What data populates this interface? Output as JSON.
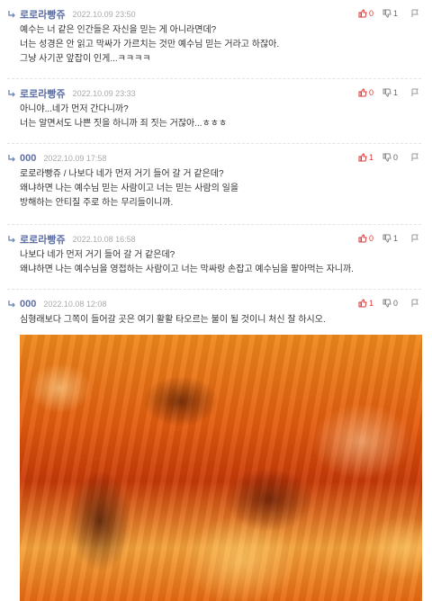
{
  "icons": {
    "reply": "reply-arrow-icon",
    "upvote": "thumbs-up-icon",
    "downvote": "thumbs-down-icon",
    "report": "report-icon"
  },
  "colors": {
    "author": "#5b6ea6",
    "upvote": "#d93a3a",
    "text": "#333333"
  },
  "comments": [
    {
      "author": "로로라빵쥬",
      "date": "2022.10.09 23:50",
      "up": "0",
      "down": "1",
      "lines": [
        "예수는 너 같은 인간들은 자신을 믿는 게 아니라면데?",
        "너는 성경은 안 읽고 막싸가 가르치는 것만 예수님 믿는 거라고 하잖아.",
        "그냥 사기꾼 앞잡이 인게...ㅋㅋㅋㅋ"
      ]
    },
    {
      "author": "로로라빵쥬",
      "date": "2022.10.09 23:33",
      "up": "0",
      "down": "1",
      "lines": [
        "아니야...네가 먼저 간다니까?",
        "너는 알면서도 나쁜 짓을 하니까 죄 짓는 거잖아...ㅎㅎㅎ"
      ]
    },
    {
      "author": "000",
      "date": "2022.10.09 17:58",
      "up": "1",
      "down": "0",
      "lines": [
        "로로라빵쥬 / 나보다 네가 먼저 거기 들어 갈 거 같은데?",
        "왜냐하면 나는 예수님 믿는 사람이고 너는 믿는 사람의 일을",
        "방해하는 안티질 주로 하는 무리들이니까."
      ]
    },
    {
      "author": "로로라빵쥬",
      "date": "2022.10.08 16:58",
      "up": "0",
      "down": "1",
      "lines": [
        "나보다 네가 먼저 거기 들어 갈 거 같은데?",
        "왜냐하면 나는 예수님을 영접하는 사람이고 너는 막싸랑 손잡고 예수님을 팔아먹는 자니까."
      ]
    },
    {
      "author": "000",
      "date": "2022.10.08 12:08",
      "up": "1",
      "down": "0",
      "lines": [
        "심형래보다 그쪽이 들어갈 곳은 여기 활활 타오르는 불이 될 것이니 처신 잘 하시오."
      ]
    }
  ]
}
